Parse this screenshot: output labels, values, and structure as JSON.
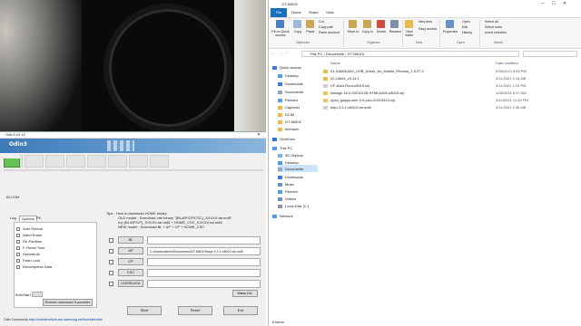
{
  "odin": {
    "title": "Odin3 v3.14",
    "logo": "Odin3",
    "id_com": "ID:COM",
    "tabs": [
      "Log",
      "Options",
      "Pit"
    ],
    "options": [
      "Auto Reboot",
      "Nand Erase",
      "Re-Partition",
      "F. Reset Time",
      "DeviceInfo",
      "Flash Lock",
      "Decompress Data"
    ],
    "autostart_label": "AutoStart",
    "reboot_button": "Reboot download if possible",
    "tips": [
      "Tips - How to download HOME binary",
      "OLD model  : Download one binary   \"(BL/AP/CP/CSC)_XXXXX.tar.md5\"",
      "NEW model  : Download BL + AP + CP + HOME_CSC",
      "ex) (BL/AP/CP)_XXXXX.tar.md5 + HOME_CSC_XXXXX.tar.md5"
    ],
    "files": [
      {
        "label": "BL",
        "path": ""
      },
      {
        "label": "AP",
        "path": "C:\\Users\\admin\\Documents\\GT-N8010\\twrp-3.3.1-n8010.tar.md5"
      },
      {
        "label": "CP",
        "path": ""
      },
      {
        "label": "CSC",
        "path": ""
      },
      {
        "label": "USERDATA",
        "path": ""
      }
    ],
    "mass_dl": "Mass D/L",
    "actions": [
      "Start",
      "Reset",
      "Exit"
    ],
    "community_label": "Odin Community :",
    "community_link": "http://mobilerndhub.sec.samsung.net/hub/site/odin/"
  },
  "explorer": {
    "title": "GT-N8010",
    "ribbon_tabs": [
      "File",
      "Home",
      "Share",
      "View"
    ],
    "ribbon_buttons": [
      "Pin to Quick access",
      "Copy",
      "Paste",
      "Move to",
      "Copy to",
      "Delete",
      "Rename",
      "New folder",
      "Properties",
      "Open",
      "Select all",
      "Select none",
      "Invert selection"
    ],
    "ribbon_small": [
      "Cut",
      "Copy path",
      "Paste shortcut",
      "New item",
      "Easy access",
      "Edit",
      "History"
    ],
    "groups": [
      "Clipboard",
      "Organize",
      "New",
      "Open",
      "Select"
    ],
    "address": [
      "This PC",
      "Documents",
      "GT-N8010"
    ],
    "columns": [
      "Name",
      "Date modified"
    ],
    "nav": [
      "Quick access",
      "Desktop",
      "Downloads",
      "Documents",
      "Pictures",
      "Captures",
      "DCIM",
      "GT-N8010",
      "lenmach",
      "OneDrive",
      "This PC",
      "3D Objects",
      "Desktop",
      "Documents",
      "Downloads",
      "Music",
      "Pictures",
      "Videos",
      "Local Disk (C:)",
      "Network"
    ],
    "files": [
      {
        "name": "01-SAMSUNG_USB_Driver_for_Mobile_Phones_1.5.27.0",
        "date": "9/26/2013 8:53 PM",
        "color": "#e9b949"
      },
      {
        "name": "02-Odin3_v3.14.1",
        "date": "4/11/2021 2:14 AM",
        "color": "#e9b949"
      },
      {
        "name": "CF-Auto-Root-n8010.tar",
        "date": "4/11/2021 1:03 PM",
        "color": "#cfcfcf"
      },
      {
        "name": "lineage-16.0-20210128-HTMLA405-n8010.zip",
        "date": "1/28/2021 5:07 AM",
        "color": "#e9c46a"
      },
      {
        "name": "open_gapps-arm-9.0-pico-20210410.zip",
        "date": "4/10/2021 11:35 PM",
        "color": "#e9c46a"
      },
      {
        "name": "twrp-3.3.1-n8010.tar.md5",
        "date": "4/11/2021 2:36 AM",
        "color": "#cfcfcf"
      }
    ],
    "status": "6 items"
  }
}
